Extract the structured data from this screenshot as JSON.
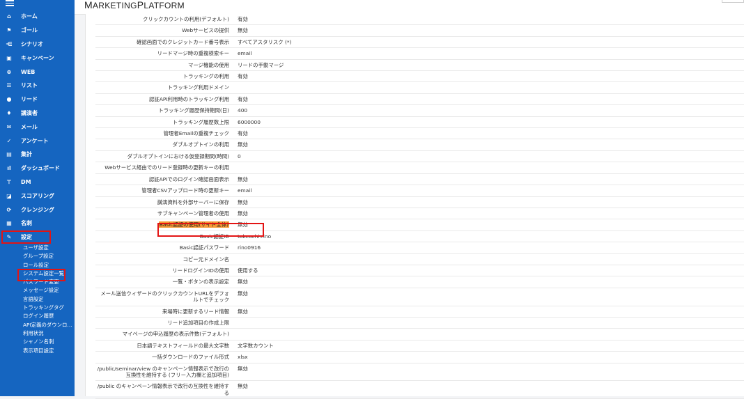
{
  "app": {
    "logo_top": "MARKETING",
    "logo_bottom_a": "M",
    "logo_bottom_b": "ARKETING",
    "logo_c": "P",
    "logo_d": "LATFORM"
  },
  "sidebar": {
    "items": [
      {
        "label": "ホーム",
        "icon": "home-icon"
      },
      {
        "label": "ゴール",
        "icon": "flag-icon"
      },
      {
        "label": "シナリオ",
        "icon": "scenario-icon"
      },
      {
        "label": "キャンペーン",
        "icon": "calendar-icon"
      },
      {
        "label": "WEB",
        "icon": "globe-icon"
      },
      {
        "label": "リスト",
        "icon": "list-icon"
      },
      {
        "label": "リード",
        "icon": "user-icon"
      },
      {
        "label": "講演者",
        "icon": "mic-icon"
      },
      {
        "label": "メール",
        "icon": "mail-icon"
      },
      {
        "label": "アンケート",
        "icon": "check-icon"
      },
      {
        "label": "集計",
        "icon": "tally-icon"
      },
      {
        "label": "ダッシュボード",
        "icon": "bar-chart-icon"
      },
      {
        "label": "DM",
        "icon": "dm-icon"
      },
      {
        "label": "スコアリング",
        "icon": "score-icon"
      },
      {
        "label": "クレンジング",
        "icon": "cleansing-icon"
      },
      {
        "label": "名刺",
        "icon": "card-icon"
      },
      {
        "label": "設定",
        "icon": "wrench-icon"
      }
    ],
    "sub_items": [
      "ユーザ設定",
      "グループ設定",
      "ロール設定",
      "システム設定一覧",
      "パスワード変更",
      "メッセージ設定",
      "言語設定",
      "トラッキングタグ",
      "ログイン履歴",
      "API定義のダウンロ…",
      "利用状況",
      "シャノン名刺",
      "表示項目設定"
    ]
  },
  "settings": [
    {
      "k": "クリックカウントの利用(デフォルト)",
      "v": "有効"
    },
    {
      "k": "Webサービスの提供",
      "v": "無効"
    },
    {
      "k": "確認画面でのクレジットカード番号表示",
      "v": "すべてアスタリスク (*)"
    },
    {
      "k": "リードマージ時の重複検索キー",
      "v": "email"
    },
    {
      "k": "マージ機能の使用",
      "v": "リードの手動マージ"
    },
    {
      "k": "トラッキングの利用",
      "v": "有効"
    },
    {
      "k": "トラッキング利用ドメイン",
      "v": ""
    },
    {
      "k": "認証API利用時のトラッキング利用",
      "v": "有効"
    },
    {
      "k": "トラッキング履歴保持期間(日)",
      "v": "400"
    },
    {
      "k": "トラッキング履歴数上限",
      "v": "6000000"
    },
    {
      "k": "管理者Emailの重複チェック",
      "v": "有効"
    },
    {
      "k": "ダブルオプトインの利用",
      "v": "無効"
    },
    {
      "k": "ダブルオプトインにおける仮登録期間(時間)",
      "v": "0"
    },
    {
      "k": "Webサービス経由でのリード登録時の更新キーの利用",
      "v": ""
    },
    {
      "k": "認証APIでのログイン確認画面表示",
      "v": "無効"
    },
    {
      "k": "管理者CSVアップロード時の更新キー",
      "v": "email"
    },
    {
      "k": "講演資料を外部サーバーに保存",
      "v": "無効"
    },
    {
      "k": "サブキャンペーン管理者の使用",
      "v": "無効"
    },
    {
      "k": "Basic認証の使用(サイト全体)",
      "v": "無効"
    },
    {
      "k": "Basic認証ID",
      "v": "takeuchi.rino"
    },
    {
      "k": "Basic認証パスワード",
      "v": "rino0916"
    },
    {
      "k": "コピー元ドメイン名",
      "v": ""
    },
    {
      "k": "リードログインIDの使用",
      "v": "使用する"
    },
    {
      "k": "一覧・ボタンの表示設定",
      "v": "無効"
    },
    {
      "k": "メール送信ウィザードのクリックカウントURLをデフォルトでチェック",
      "v": "無効"
    },
    {
      "k": "来場時に更新するリード情報",
      "v": "無効"
    },
    {
      "k": "リード追加項目の作成上限",
      "v": ""
    },
    {
      "k": "マイページの申込履歴の表示件数(デフォルト)",
      "v": ""
    },
    {
      "k": "日本語テキストフィールドの最大文字数",
      "v": "文字数カウント"
    },
    {
      "k": "一括ダウンロードのファイル形式",
      "v": "xlsx"
    },
    {
      "k": "/public/seminar/view のキャンペーン情報表示で改行の互換性を維持する (フリー入力欄と追加項目)",
      "v": "無効"
    },
    {
      "k": "/public のキャンペーン情報表示で改行の互換性を維持する",
      "v": "無効"
    }
  ],
  "colors": {
    "sidebar": "#1565c0",
    "highlight_box": "#e31414",
    "highlight_fill": "#f59a35"
  }
}
